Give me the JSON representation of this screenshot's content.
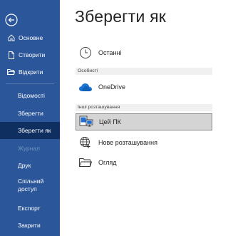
{
  "sidebar": {
    "back_icon": "circle-arrow-left-icon",
    "nav_top": [
      {
        "label": "Основне",
        "icon": "home-icon"
      },
      {
        "label": "Створити",
        "icon": "new-document-icon"
      },
      {
        "label": "Відкрити",
        "icon": "open-folder-icon"
      }
    ],
    "nav_bottom": [
      {
        "label": "Відомості"
      },
      {
        "label": "Зберегти"
      },
      {
        "label": "Зберегти як",
        "active": true
      },
      {
        "label": "Журнал",
        "disabled": true
      },
      {
        "label": "Друк"
      },
      {
        "label": "Спільний доступ"
      },
      {
        "label": "Експорт"
      },
      {
        "label": "Закрити"
      }
    ],
    "colors": {
      "background": "#2b579a",
      "active": "#0f2f60"
    }
  },
  "main": {
    "title": "Зберегти як",
    "recent_label": "Останні",
    "section_personal": "Особисті",
    "onedrive_label": "OneDrive",
    "section_other": "Інші розташування",
    "this_pc_label": "Цей ПК",
    "add_place_label": "Нове розташування",
    "browse_label": "Огляд"
  }
}
